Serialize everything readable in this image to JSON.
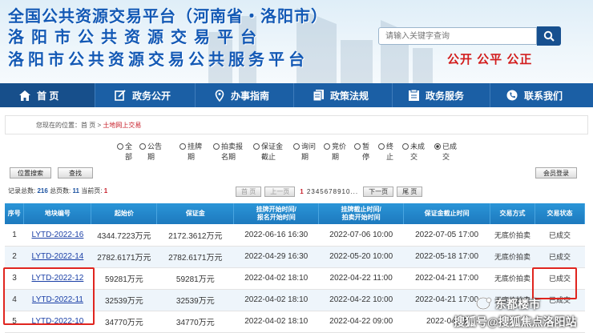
{
  "header": {
    "title_line1": "全国公共资源交易平台（河南省・洛阳市）",
    "title_line2": "洛阳市公共资源交易平台",
    "title_line3": "洛阳市公共资源交易公共服务平台",
    "search_placeholder": "请输入关键字查询",
    "slogan": "公开 公平 公正"
  },
  "nav": [
    {
      "label": "首 页",
      "icon": "home-icon"
    },
    {
      "label": "政务公开",
      "icon": "edit-icon"
    },
    {
      "label": "办事指南",
      "icon": "location-pin-icon"
    },
    {
      "label": "政策法规",
      "icon": "document-icon"
    },
    {
      "label": "政务服务",
      "icon": "clipboard-icon"
    },
    {
      "label": "联系我们",
      "icon": "phone-icon"
    }
  ],
  "breadcrumb": {
    "prefix": "您现在的位置：",
    "home": "首 页",
    "sep": ">",
    "current": "土地网上交易"
  },
  "filters": [
    {
      "l1": "全",
      "l2": "部",
      "selected": false
    },
    {
      "l1": "公告",
      "l2": "期",
      "selected": false
    },
    {
      "l1": "挂牌",
      "l2": "期",
      "selected": false
    },
    {
      "l1": "拍卖报",
      "l2": "名期",
      "selected": false
    },
    {
      "l1": "保证金",
      "l2": "截止",
      "selected": false
    },
    {
      "l1": "询问",
      "l2": "期",
      "selected": false
    },
    {
      "l1": "竞价",
      "l2": "期",
      "selected": false
    },
    {
      "l1": "暂",
      "l2": "停",
      "selected": false
    },
    {
      "l1": "终",
      "l2": "止",
      "selected": false
    },
    {
      "l1": "未成",
      "l2": "交",
      "selected": false
    },
    {
      "l1": "已成",
      "l2": "交",
      "selected": true
    }
  ],
  "buttons": {
    "position_search": "位置搜索",
    "query": "查找",
    "member_login": "会员登录"
  },
  "stats": {
    "total_label": "记录总数:",
    "total": "216",
    "pages_label": "总页数:",
    "pages": "11",
    "current_label": "当前页:",
    "current": "1"
  },
  "pager": {
    "first": "首 页",
    "prev": "上一页",
    "page_current": "1",
    "page_rest": "2345678910",
    "ellipsis": "...",
    "next": "下一页",
    "last": "尾 页"
  },
  "table": {
    "headers": [
      "序号",
      "地块编号",
      "起始价",
      "保证金",
      "挂牌开始时间/\n报名开始时间",
      "挂牌截止时间/\n拍卖开始时间",
      "保证金截止时间",
      "交易方式",
      "交易状态"
    ],
    "rows": [
      {
        "no": "1",
        "code": "LYTD-2022-16",
        "start_price": "4344.7223万元",
        "deposit": "2172.3612万元",
        "listing_start": "2022-06-16 16:30",
        "listing_end": "2022-07-06 10:00",
        "deposit_deadline": "2022-07-05 17:00",
        "method": "无底价拍卖",
        "status": "已成交"
      },
      {
        "no": "2",
        "code": "LYTD-2022-14",
        "start_price": "2782.6171万元",
        "deposit": "2782.6171万元",
        "listing_start": "2022-04-29 16:30",
        "listing_end": "2022-05-20 10:00",
        "deposit_deadline": "2022-05-18 17:00",
        "method": "无底价拍卖",
        "status": "已成交"
      },
      {
        "no": "3",
        "code": "LYTD-2022-12",
        "start_price": "59281万元",
        "deposit": "59281万元",
        "listing_start": "2022-04-02 18:10",
        "listing_end": "2022-04-22 11:00",
        "deposit_deadline": "2022-04-21 17:00",
        "method": "无底价拍卖",
        "status": "已成交"
      },
      {
        "no": "4",
        "code": "LYTD-2022-11",
        "start_price": "32539万元",
        "deposit": "32539万元",
        "listing_start": "2022-04-02 18:10",
        "listing_end": "2022-04-22 10:00",
        "deposit_deadline": "2022-04-21 17:00",
        "method": "无底价拍卖",
        "status": "已成交"
      },
      {
        "no": "5",
        "code": "LYTD-2022-10",
        "start_price": "34770万元",
        "deposit": "34770万元",
        "listing_start": "2022-04-02 18:10",
        "listing_end": "2022-04-22 09:00",
        "deposit_deadline": "2022-04-21",
        "method": "",
        "status": ""
      }
    ]
  },
  "watermark": {
    "line1": "东都楼市",
    "line2": "搜狐号@搜狐焦点洛阳站"
  },
  "colors": {
    "nav_bg": "#1b5fa5",
    "header_title": "#1359b5",
    "slogan": "#d21d1d",
    "table_header": "#1d79be",
    "highlight_box": "#e0251f"
  }
}
